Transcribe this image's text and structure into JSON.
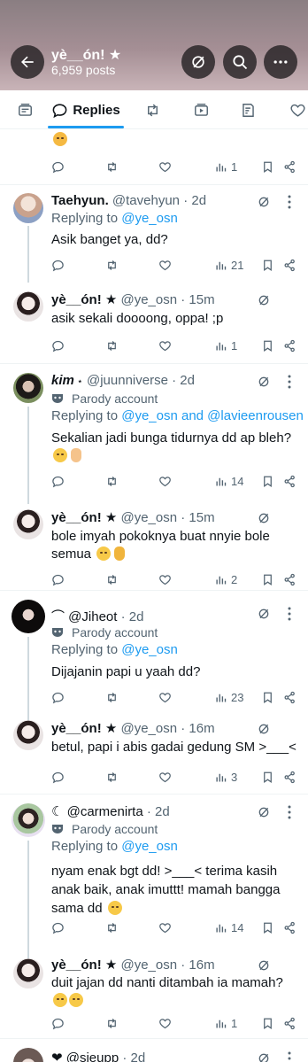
{
  "header": {
    "title": "yè__ón! ★",
    "post_count": "6,959 posts"
  },
  "tabs": {
    "replies_label": "Replies"
  },
  "posts": [
    {
      "id": "p0",
      "text_tail": "",
      "stats": {
        "views": "1"
      }
    },
    {
      "id": "p1",
      "name": "Taehyun.",
      "handle": "@tavehyun",
      "time": "· 2d",
      "reply_prefix": "Replying to ",
      "reply_to": "@ye_osn",
      "text": "Asik banget ya, dd?",
      "stats": {
        "views": "21"
      }
    },
    {
      "id": "p2",
      "name": "yè__ón! ★",
      "handle": "@ye_osn",
      "time": "· 15m",
      "text": "asik sekali doooong, oppa! ;p",
      "stats": {
        "views": "1"
      }
    },
    {
      "id": "p3",
      "name": "kim",
      "name_suffix": " ⋆",
      "handle": "@juunniverse",
      "time": "· 2d",
      "parody": "Parody account",
      "reply_prefix": "Replying to ",
      "reply_to": "@ye_osn and @lavieenrousen",
      "text": "Sekalian jadi bunga tidurnya dd ap bleh?",
      "stats": {
        "views": "14"
      }
    },
    {
      "id": "p4",
      "name": "yè__ón! ★",
      "handle": "@ye_osn",
      "time": "· 15m",
      "text_l1": "bole imyah pokoknya buat nnyie bole",
      "text_l2": "semua",
      "stats": {
        "views": "2"
      }
    },
    {
      "id": "p5",
      "name": "⌒ @Jiheot",
      "handle": "",
      "time": "· 2d",
      "parody": "Parody account",
      "reply_prefix": "Replying to ",
      "reply_to": "@ye_osn",
      "text": "Dijajanin papi u yaah dd?",
      "stats": {
        "views": "23"
      }
    },
    {
      "id": "p6",
      "name": "yè__ón! ★",
      "handle": "@ye_osn",
      "time": "· 16m",
      "text": "betul, papi i abis gadai gedung SM >___<",
      "stats": {
        "views": "3"
      }
    },
    {
      "id": "p7",
      "name": "☾ @carmenirta",
      "handle": "",
      "time": "· 2d",
      "parody": "Parody account",
      "reply_prefix": "Replying to ",
      "reply_to": "@ye_osn",
      "text_l1": "nyam enak bgt dd! >___< terima kasih",
      "text_l2": "anak baik, anak imuttt! mamah bangga",
      "text_l3": "sama dd",
      "stats": {
        "views": "14"
      }
    },
    {
      "id": "p8",
      "name": "yè__ón! ★",
      "handle": "@ye_osn",
      "time": "· 16m",
      "text": "duit jajan dd nanti ditambah ia mamah?",
      "stats": {
        "views": "1"
      }
    },
    {
      "id": "p9",
      "name": "❤ @sieupp",
      "handle": "",
      "time": "· 2d"
    }
  ],
  "icons": {
    "back": "arrow-left-icon",
    "grok": "grok-icon",
    "search": "search-icon",
    "more": "more-icon",
    "reply": "reply-icon",
    "repost": "repost-icon",
    "like": "like-icon",
    "views": "views-icon",
    "bookmark": "bookmark-icon",
    "share": "share-icon"
  },
  "colors": {
    "accent": "#1d9bf0",
    "text": "#0f1419",
    "secondary": "#536471"
  }
}
